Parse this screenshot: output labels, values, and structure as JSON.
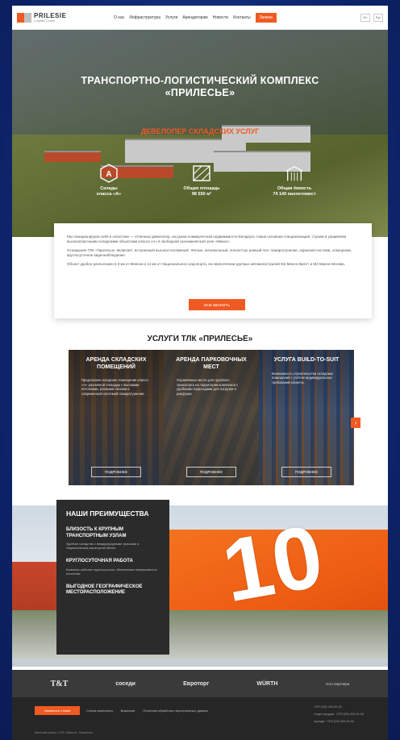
{
  "header": {
    "logo_name": "PRILESIE",
    "logo_sub": "Logistic Center",
    "nav": [
      "О нас",
      "Инфраструктура",
      "Услуги",
      "Арендаторам",
      "Новости",
      "Контакты"
    ],
    "cta": "Заявка",
    "lang": [
      "En",
      "Рус"
    ]
  },
  "hero": {
    "title_line1": "ТРАНСПОРТНО-ЛОГИСТИЧЕСКИЙ КОМПЛЕКС",
    "title_line2": "«ПРИЛЕСЬЕ»",
    "subtitle": "ДЕВЕЛОПЕР СКЛАДСКИХ УСЛУГ",
    "stats": [
      {
        "label1": "Склады",
        "label2": "класса «А»"
      },
      {
        "label1": "Общая площадь",
        "label2": "98 550 м²"
      },
      {
        "label1": "Общая ёмкость",
        "label2": "74 140 паллетомест"
      }
    ]
  },
  "about": {
    "p1": "Мы позиционируем себя в логистике — отличных девелопер, на рынке коммерческой недвижимости Беларуси. Наша основная специализация: строим и управляем высококлассными складскими объектами класса «А» в свободной экономической зоне «Минск».",
    "p2": "Оснащение ТЛК «Прилесье» включает: встроенный высокостеллажный, тёплые, антипыльный, полностью ровный пол, пожаротушение, охранная система, освещение, круглосуточное видеонаблюдение.",
    "p3": "Объект удобно расположен в 3 км от Минска и 14 км от Национального аэропорта, на пересечении крупных автомагистралей М4 Минск–Брест и М2 Минск–Москва.",
    "button": "ВАМ ЗВОНИТЬ"
  },
  "services": {
    "title": "УСЛУГИ ТЛК «ПРИЛЕСЬЕ»",
    "items": [
      {
        "title": "АРЕНДА СКЛАДСКИХ ПОМЕЩЕНИЙ",
        "desc": "Предлагаем складские помещения класса «А» различной площади с высокими потолками, ровными полами и современной системой пожаротушения.",
        "button": "ПОДРОБНЕЕ"
      },
      {
        "title": "АРЕНДА ПАРКОВОЧНЫХ МЕСТ",
        "desc": "Охраняемые места для грузового транспорта на территории комплекса с удобными подъездами для погрузки и разгрузки.",
        "button": "ПОДРОБНЕЕ"
      },
      {
        "title": "УСЛУГА BUILD-TO-SUIT",
        "desc": "Возможность строительства складских помещений с учётом индивидуальных требований клиента.",
        "button": "ПОДРОБНЕЕ"
      }
    ],
    "next_glyph": "›"
  },
  "advantages": {
    "title": "НАШИ ПРЕИМУЩЕСТВА",
    "items": [
      {
        "title": "БЛИЗОСТЬ К КРУПНЫМ ТРАНСПОРТНЫМ УЗЛАМ",
        "desc": "Удобное соседство с международными трассами и Национальным аэропортом Минск."
      },
      {
        "title": "КРУГЛОСУТОЧНАЯ РАБОТА",
        "desc": "Комплекс работает круглосуточно, обеспечивая непрерывность логистики."
      },
      {
        "title": "ВЫГОДНОЕ ГЕОГРАФИЧЕСКОЕ МЕСТОРАСПОЛОЖЕНИЕ",
        "desc": ""
      }
    ],
    "big_number": "10"
  },
  "partners": [
    "T&T",
    "соседи",
    "Евроторг",
    "WÜRTH",
    "лого партнёра"
  ],
  "footer": {
    "cta": "Связаться с нами",
    "links": [
      "Схема комплекса",
      "Вакансии",
      "Политика обработки персональных данных"
    ],
    "contacts": [
      "+375 (29) 000-00-00",
      "Отдел продаж: +375 (29) 000-00-00",
      "Аренда: +375 (29) 000-00-00"
    ],
    "address": "Минский район, СЭЗ «Минск», Прилесье"
  },
  "colors": {
    "accent": "#f05a22",
    "dark": "#2b2b2b",
    "background": "#0f2670"
  }
}
